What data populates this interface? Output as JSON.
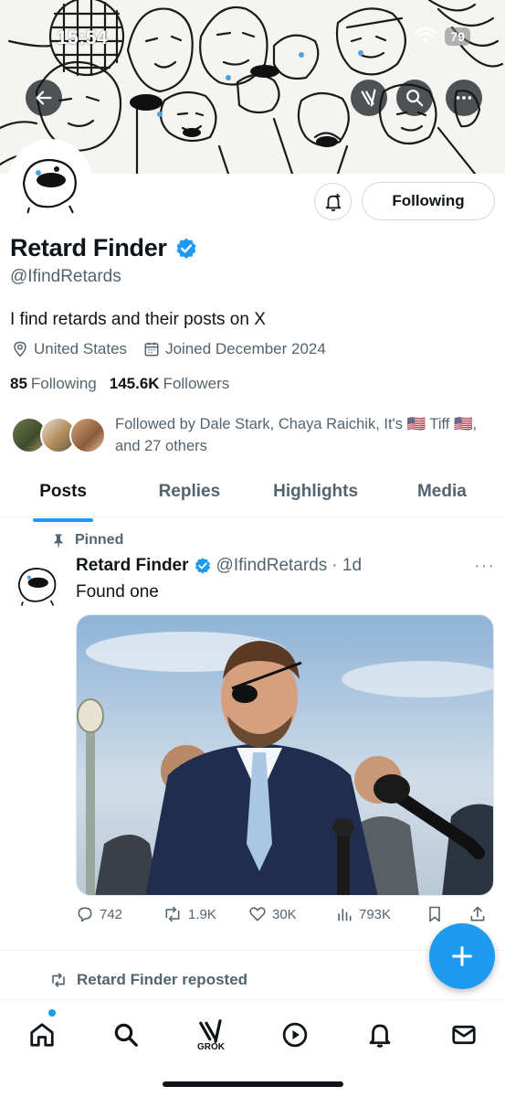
{
  "status_bar": {
    "time": "15:54",
    "battery": "79"
  },
  "profile": {
    "display_name": "Retard Finder",
    "handle": "@IfindRetards",
    "bio": "I find retards and their posts on X",
    "location": "United States",
    "joined": "Joined December 2024",
    "following_count": "85",
    "following_label": "Following",
    "followers_count": "145.6K",
    "followers_label": "Followers",
    "followed_by": "Followed by Dale Stark, Chaya Raichik, It's 🇺🇸 Tiff 🇺🇸, and 27 others",
    "following_button": "Following",
    "verified_color": "#1d9bf0"
  },
  "tabs": [
    {
      "label": "Posts",
      "active": true
    },
    {
      "label": "Replies",
      "active": false
    },
    {
      "label": "Highlights",
      "active": false
    },
    {
      "label": "Media",
      "active": false
    }
  ],
  "pinned_post": {
    "pinned_label": "Pinned",
    "author": "Retard Finder",
    "handle": "@IfindRetards",
    "time": "· 1d",
    "text": "Found one",
    "replies": "742",
    "reposts": "1.9K",
    "likes": "30K",
    "views": "793K"
  },
  "next_item": {
    "reposted_label": "Retard Finder reposted"
  },
  "bottom_nav": {
    "items": [
      "home-icon",
      "search-icon",
      "grok-icon",
      "video-icon",
      "notifications-icon",
      "messages-icon"
    ],
    "grok_label": "GROK"
  },
  "colors": {
    "accent": "#1d9bf0",
    "secondary_text": "#536471"
  }
}
